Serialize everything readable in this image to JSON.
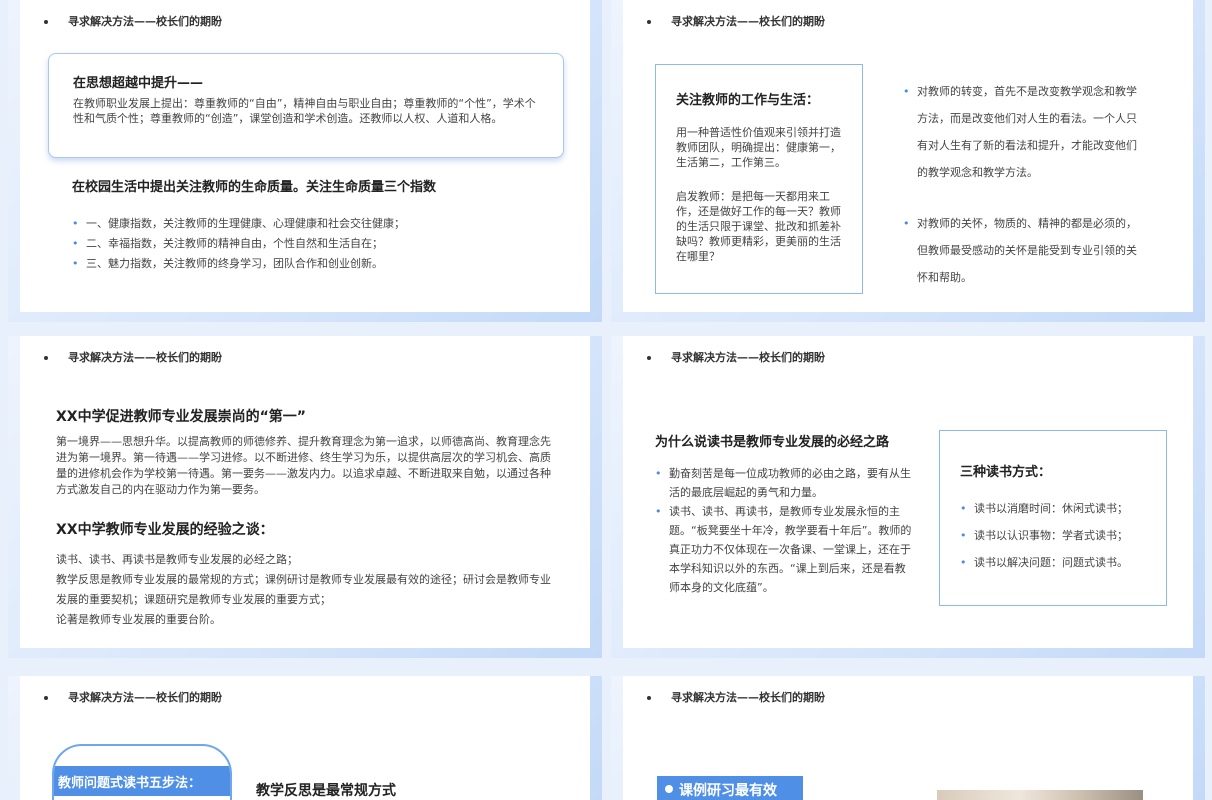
{
  "header": "寻求解决方法——校长们的期盼",
  "s1": {
    "card_title": "在思想超越中提升——",
    "card_body": "在教师职业发展上提出：尊重教师的“自由”，精神自由与职业自由；尊重教师的“个性”，学术个性和气质个性；尊重教师的“创造”，课堂创造和学术创造。还教师以人权、人道和人格。",
    "heading": "在校园生活中提出关注教师的生命质量。关注生命质量三个指数",
    "items": [
      "一、健康指数，关注教师的生理健康、心理健康和社会交往健康；",
      "二、幸福指数，关注教师的精神自由，个性自然和生活自在；",
      "三、魅力指数，关注教师的终身学习，团队合作和创业创新。"
    ]
  },
  "s2": {
    "box_title": "关注教师的工作与生活：",
    "box_p1": "用一种普适性价值观来引领并打造教师团队，明确提出：健康第一，生活第二，工作第三。",
    "box_p2": "启发教师：是把每一天都用来工作，还是做好工作的每一天？教师的生活只限于课堂、批改和抓差补缺吗？教师更精彩，更美丽的生活在哪里？",
    "b1": "对教师的转变，首先不是改变教学观念和教学方法，而是改变他们对人生的看法。一个人只有对人生有了新的看法和提升，才能改变他们的教学观念和教学方法。",
    "b2": "对教师的关怀，物质的、精神的都是必须的，但教师最受感动的关怀是能受到专业引领的关怀和帮助。"
  },
  "s3": {
    "h1": "XX中学促进教师专业发展崇尚的“第一”",
    "p1": "第一境界——思想升华。以提高教师的师德修养、提升教育理念为第一追求，以师德高尚、教育理念先进为第一境界。第一待遇——学习进修。以不断进修、终生学习为乐，以提供高层次的学习机会、高质量的进修机会作为学校第一待遇。第一要务——激发内力。以追求卓越、不断进取来自勉，以通过各种方式激发自己的内在驱动力作为第一要务。",
    "h2": "XX中学教师专业发展的经验之谈：",
    "p2a": "读书、读书、再读书是教师专业发展的必经之路；",
    "p2b": "教学反思是教师专业发展的最常规的方式；课例研讨是教师专业发展最有效的途径；研讨会是教师专业发展的重要契机；课题研究是教师专业发展的重要方式；",
    "p2c": "论著是教师专业发展的重要台阶。"
  },
  "s4": {
    "heading": "为什么说读书是教师专业发展的必经之路",
    "items": [
      "勤奋刻苦是每一位成功教师的必由之路，要有从生活的最底层崛起的勇气和力量。",
      "读书、读书、再读书，是教师专业发展永恒的主题。“板凳要坐十年冷，教学要看十年后”。教师的真正功力不仅体现在一次备课、一堂课上，还在于本学科知识以外的东西。“课上到后来，还是看教师本身的文化底蕴”。"
    ],
    "box_title": "三种读书方式：",
    "box_items": [
      "读书以消磨时间：休闲式读书；",
      "读书以认识事物：学者式读书；",
      "读书以解决问题：问题式读书。"
    ]
  },
  "s5": {
    "tab_title": "教师问题式读书五步法：",
    "heading": "教学反思是最常规方式"
  },
  "s6": {
    "banner": "课例研习最有效"
  }
}
